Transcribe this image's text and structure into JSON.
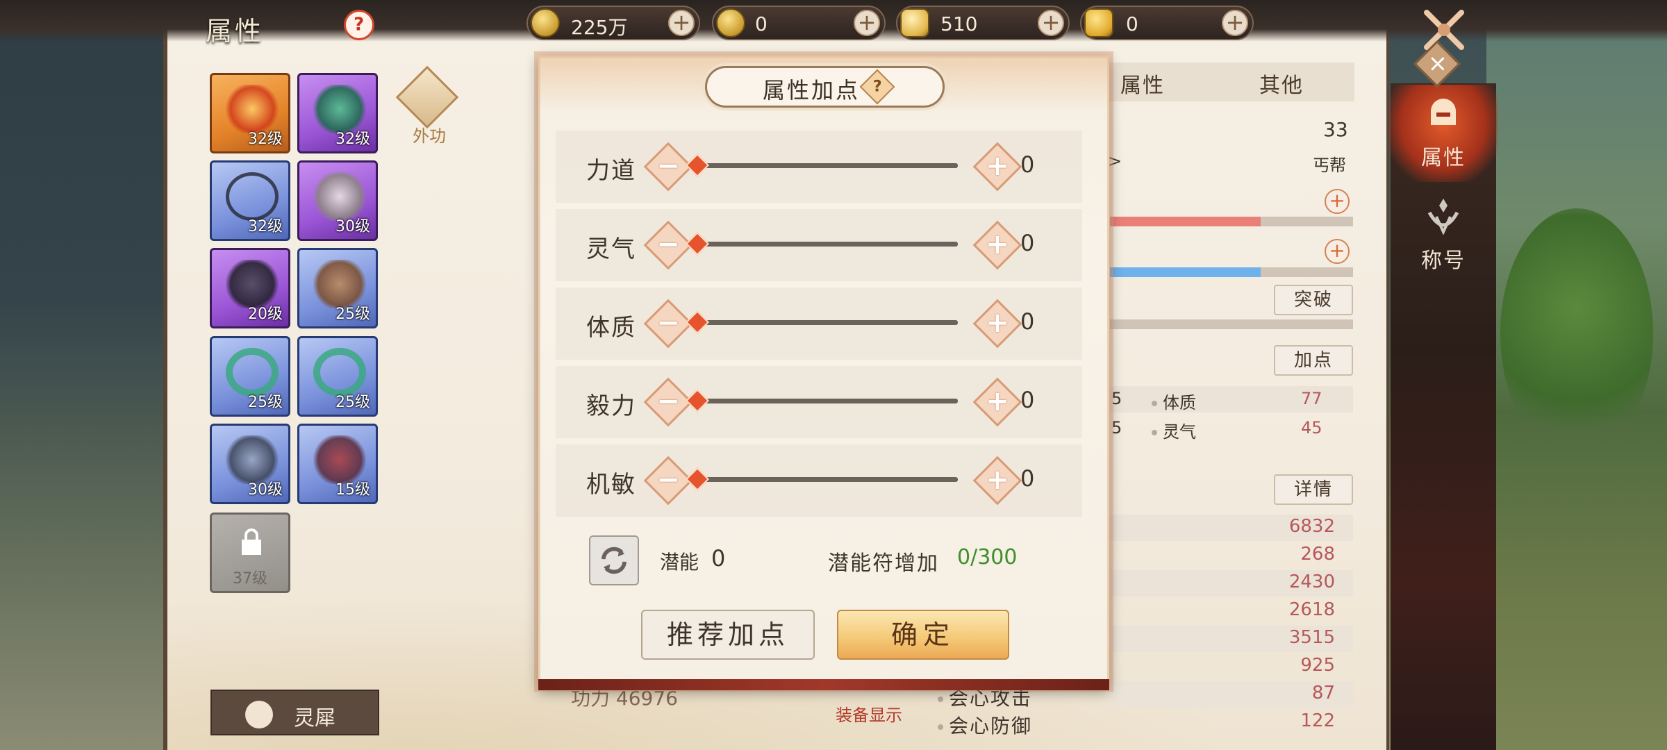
{
  "header": {
    "title": "属性",
    "help_glyph": "?",
    "currencies": [
      {
        "name": "copper-coin",
        "value": "225万"
      },
      {
        "name": "gold-coin",
        "value": "0"
      },
      {
        "name": "silver-ingot",
        "value": "510"
      },
      {
        "name": "gold-ingot",
        "value": "0"
      }
    ],
    "plus_glyph": "+"
  },
  "equipment": {
    "slots": [
      {
        "level": "32级",
        "rarity": "orange"
      },
      {
        "level": "32级",
        "rarity": "purple"
      },
      {
        "level": "32级",
        "rarity": "blue"
      },
      {
        "level": "30级",
        "rarity": "purple"
      },
      {
        "level": "20级",
        "rarity": "purple"
      },
      {
        "level": "25级",
        "rarity": "blue"
      },
      {
        "level": "25级",
        "rarity": "blue"
      },
      {
        "level": "25级",
        "rarity": "blue"
      },
      {
        "level": "30级",
        "rarity": "blue"
      },
      {
        "level": "15级",
        "rarity": "blue"
      },
      {
        "level": "37级",
        "rarity": "locked"
      }
    ],
    "waigong_label": "外功",
    "lingxi_label": "灵犀"
  },
  "dialog": {
    "title": "属性加点",
    "help_glyph": "?",
    "attributes": [
      {
        "label": "力道",
        "value": "0"
      },
      {
        "label": "灵气",
        "value": "0"
      },
      {
        "label": "体质",
        "value": "0"
      },
      {
        "label": "毅力",
        "value": "0"
      },
      {
        "label": "机敏",
        "value": "0"
      }
    ],
    "minus_glyph": "−",
    "plus_glyph": "+",
    "potential_label": "潜能",
    "potential_value": "0",
    "potential_fu_label": "潜能符增加",
    "potential_fu_value": "0/300",
    "recommend_label": "推荐加点",
    "confirm_label": "确定"
  },
  "right_panel": {
    "tabs": [
      "属性",
      "其他"
    ],
    "level": "33",
    "faction_prefix": "<",
    "faction_suffix": ">",
    "faction": "丐帮",
    "hp_fill": 0.62,
    "mp_fill": 0.62,
    "breakthrough_label": "突破",
    "addpoint_label": "加点",
    "detail_label": "详情",
    "base_stats": [
      {
        "label": "体质",
        "value": "77",
        "left": "5"
      },
      {
        "label": "灵气",
        "value": "45",
        "left": "5"
      }
    ],
    "combat_values": [
      "6832",
      "268",
      "2430",
      "2618",
      "3515",
      "925",
      "87",
      "122"
    ],
    "crit_attack_label": "会心攻击",
    "crit_defense_label": "会心防御"
  },
  "bottom": {
    "gongli_label": "功力",
    "gongli_value": "46976",
    "equip_show_label": "装备显示"
  },
  "side_nav": [
    {
      "label": "属性",
      "active": true
    },
    {
      "label": "称号",
      "active": false
    }
  ],
  "colors": {
    "accent_red": "#e6542e",
    "potential_green": "#3e8f2d",
    "hp_bar": "#ea7f78",
    "mp_bar": "#6fb1ea"
  }
}
